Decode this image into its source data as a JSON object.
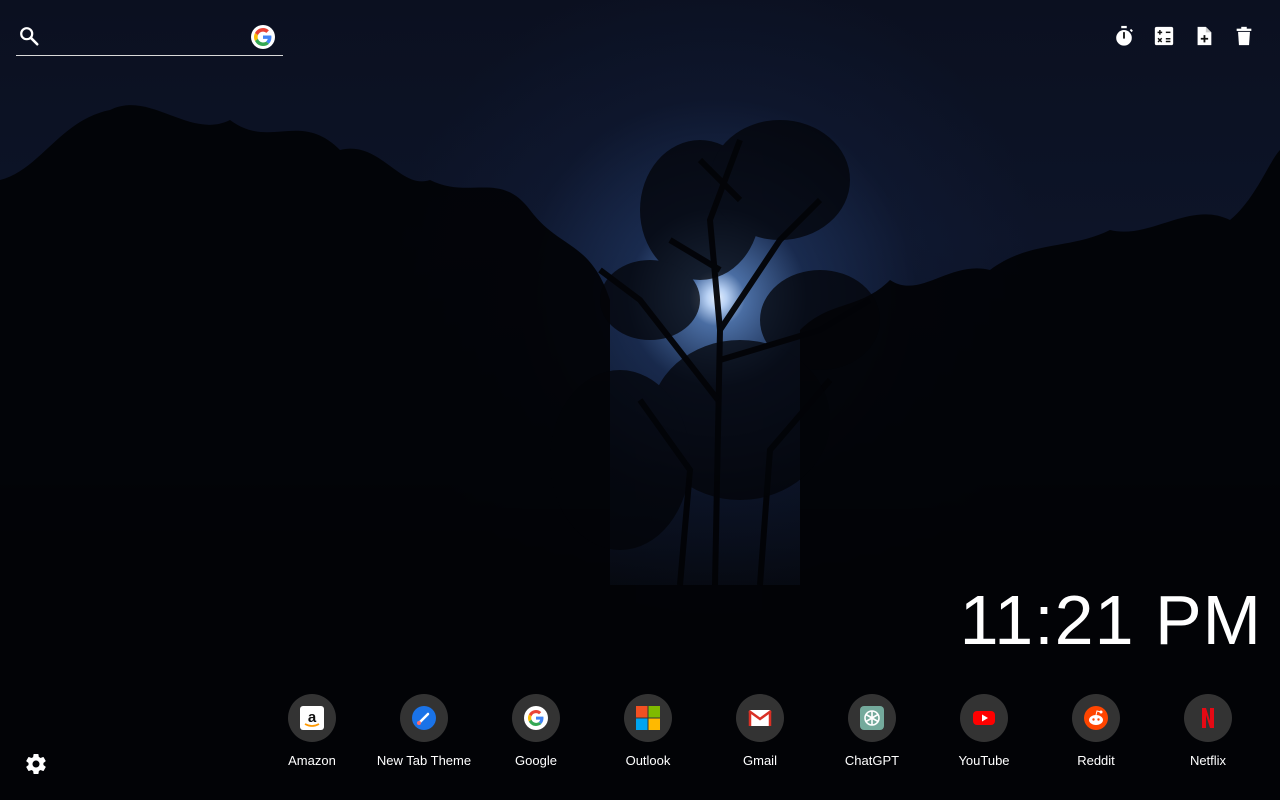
{
  "search": {
    "placeholder": "",
    "value": "",
    "engine_icon": "google-g-icon"
  },
  "tools": [
    {
      "name": "timer-icon"
    },
    {
      "name": "calculator-icon"
    },
    {
      "name": "add-note-icon"
    },
    {
      "name": "trash-icon"
    }
  ],
  "clock": {
    "time": "11:21 PM"
  },
  "shortcuts": [
    {
      "label": "Amazon",
      "icon": "amazon-icon"
    },
    {
      "label": "New Tab Theme",
      "icon": "new-tab-theme-icon"
    },
    {
      "label": "Google",
      "icon": "google-icon"
    },
    {
      "label": "Outlook",
      "icon": "outlook-icon"
    },
    {
      "label": "Gmail",
      "icon": "gmail-icon"
    },
    {
      "label": "ChatGPT",
      "icon": "chatgpt-icon"
    },
    {
      "label": "YouTube",
      "icon": "youtube-icon"
    },
    {
      "label": "Reddit",
      "icon": "reddit-icon"
    },
    {
      "label": "Netflix",
      "icon": "netflix-icon"
    }
  ],
  "settings": {
    "icon": "gear-icon"
  },
  "colors": {
    "sky": "#0d1428",
    "moon": "#e8f2ff",
    "shortcut_bg": "#3c3c3c"
  }
}
